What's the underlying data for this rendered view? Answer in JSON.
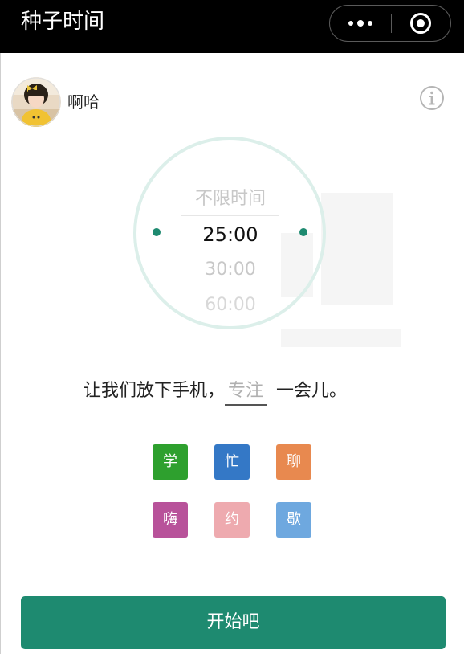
{
  "app": {
    "title": "种子时间"
  },
  "user": {
    "name": "啊哈"
  },
  "timer": {
    "options": [
      "不限时间",
      "25:00",
      "30:00",
      "60:00"
    ],
    "selected": "25:00"
  },
  "sentence": {
    "before": "让我们放下手机，",
    "input_placeholder": "专注",
    "after": "一会儿。"
  },
  "tags": [
    {
      "label": "学",
      "color": "#2ea02e"
    },
    {
      "label": "忙",
      "color": "#3478c6"
    },
    {
      "label": "聊",
      "color": "#e8894f"
    },
    {
      "label": "嗨",
      "color": "#b8529a"
    },
    {
      "label": "约",
      "color": "#eeaaaf"
    },
    {
      "label": "歇",
      "color": "#6ea8df"
    }
  ],
  "start_button": {
    "label": "开始吧"
  },
  "colors": {
    "accent": "#1e8a70",
    "topbar": "#000000",
    "dial_ring": "#dcefea"
  },
  "icons": {
    "more": "more-dots-icon",
    "close": "target-close-icon",
    "info": "info-icon"
  }
}
